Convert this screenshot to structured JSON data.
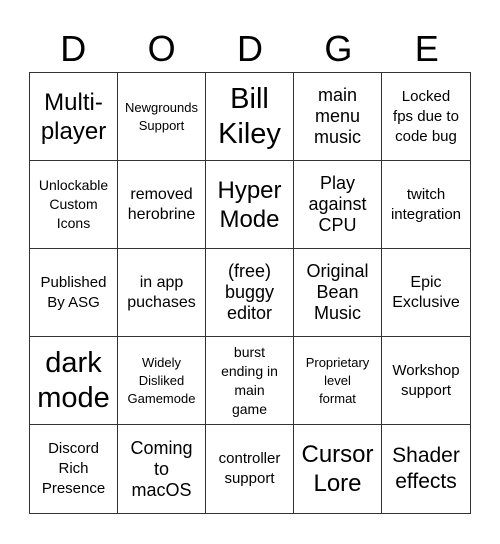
{
  "header": {
    "letters": [
      "D",
      "O",
      "D",
      "G",
      "E"
    ]
  },
  "board": {
    "cells": [
      {
        "text": "Multi-\nplayer"
      },
      {
        "text": "Newgrounds\nSupport"
      },
      {
        "text": "Bill\nKiley"
      },
      {
        "text": "main\nmenu\nmusic"
      },
      {
        "text": "Locked\nfps due to\ncode bug"
      },
      {
        "text": "Unlockable\nCustom\nIcons"
      },
      {
        "text": "removed\nherobrine"
      },
      {
        "text": "Hyper\nMode"
      },
      {
        "text": "Play\nagainst\nCPU"
      },
      {
        "text": "twitch\nintegration"
      },
      {
        "text": "Published\nBy ASG"
      },
      {
        "text": "in app\npuchases"
      },
      {
        "text": "(free)\nbuggy\neditor"
      },
      {
        "text": "Original\nBean\nMusic"
      },
      {
        "text": "Epic\nExclusive"
      },
      {
        "text": "dark\nmode"
      },
      {
        "text": "Widely\nDisliked\nGamemode"
      },
      {
        "text": "burst\nending in\nmain\ngame"
      },
      {
        "text": "Proprietary\nlevel\nformat"
      },
      {
        "text": "Workshop\nsupport"
      },
      {
        "text": "Discord\nRich\nPresence"
      },
      {
        "text": "Coming\nto\nmacOS"
      },
      {
        "text": "controller\nsupport"
      },
      {
        "text": "Cursor\nLore"
      },
      {
        "text": "Shader\neffects"
      }
    ]
  }
}
